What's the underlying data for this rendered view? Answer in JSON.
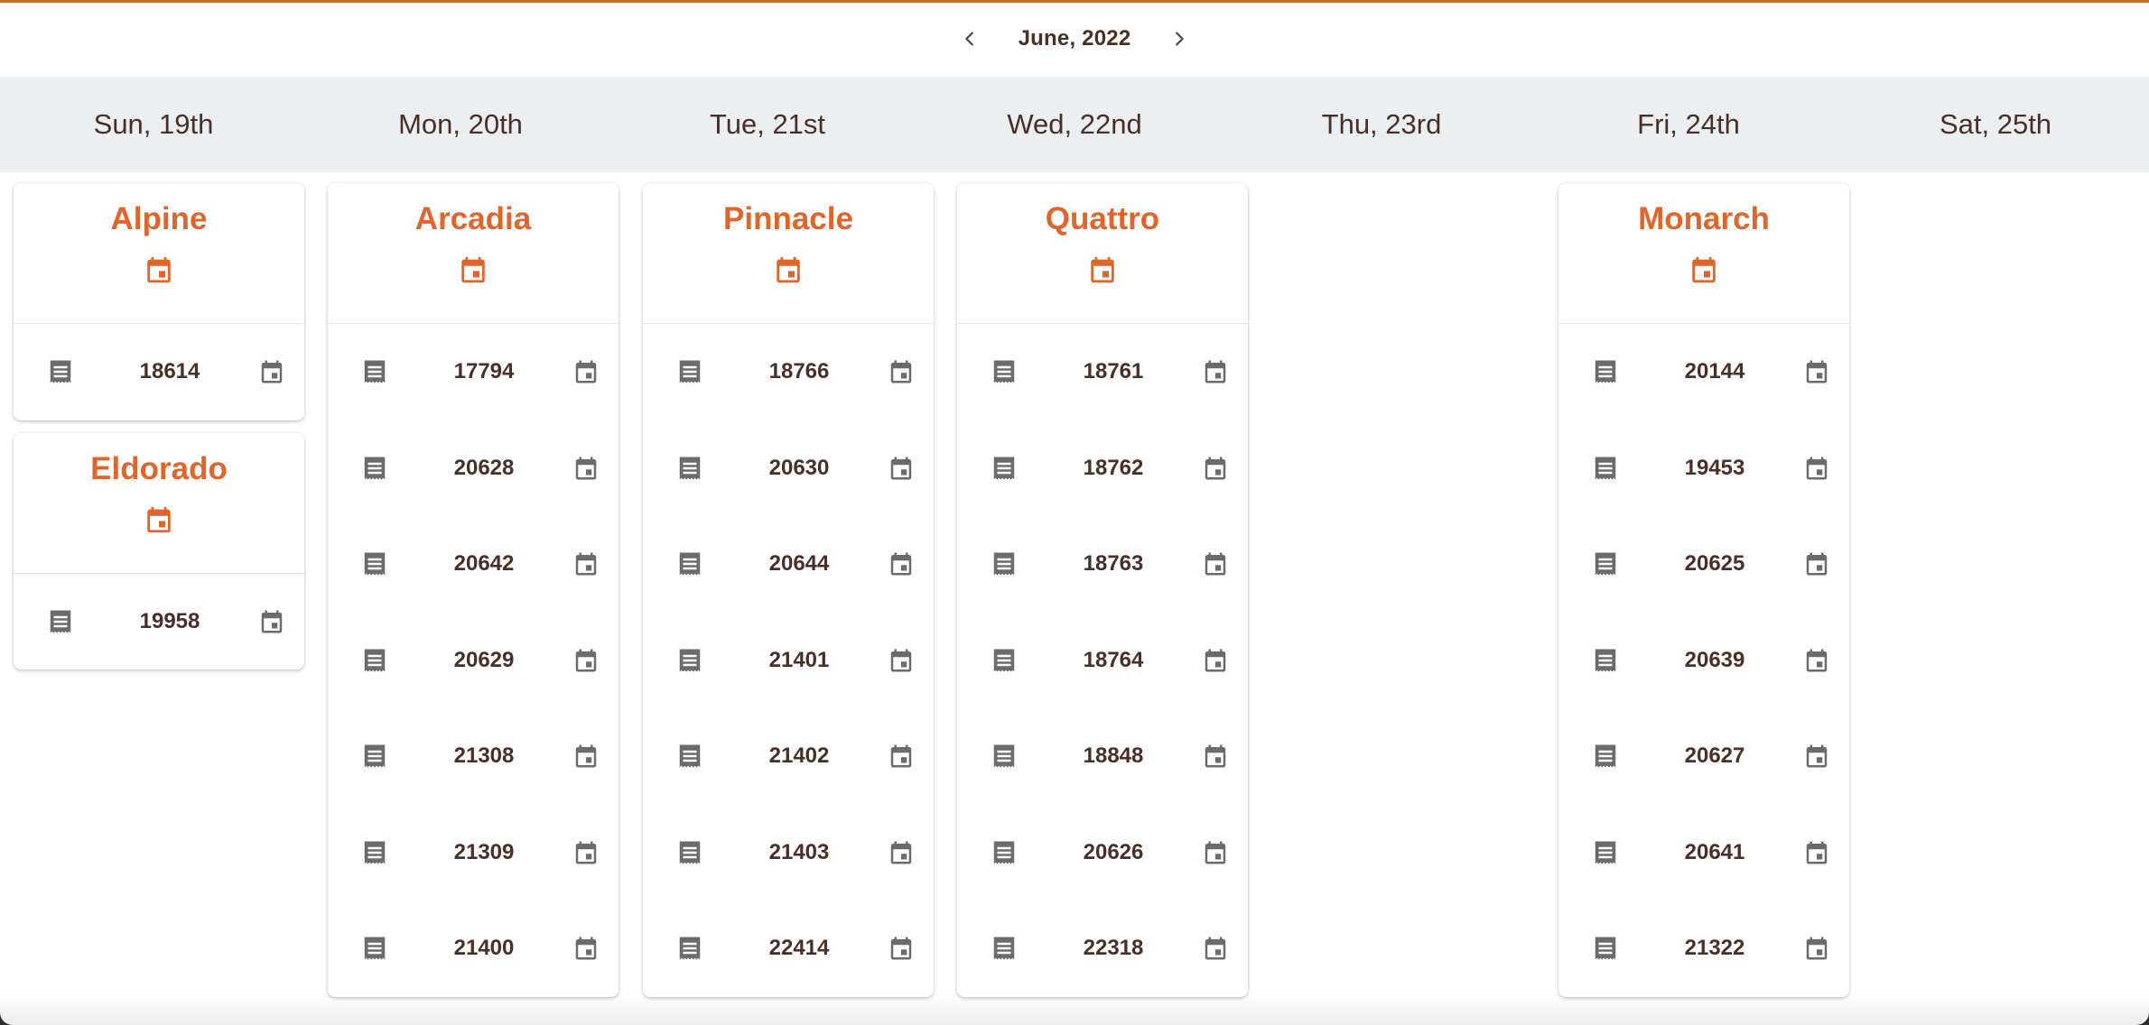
{
  "header": {
    "month": "June, 2022",
    "prev_icon": "chevron-left-icon",
    "next_icon": "chevron-right-icon"
  },
  "days": [
    "Sun, 19th",
    "Mon, 20th",
    "Tue, 21st",
    "Wed, 22nd",
    "Thu, 23rd",
    "Fri, 24th",
    "Sat, 25th"
  ],
  "colors": {
    "accent": "#e0652d",
    "text": "#4a2f26",
    "icon_gray": "#6b6b6b",
    "header_bg": "#eceff1"
  },
  "icons": {
    "row_left": "receipt-icon",
    "row_right": "event-icon",
    "card_head": "event-icon"
  },
  "cards": [
    {
      "day": "Sun, 19th",
      "title": "Alpine",
      "items": [
        "18614"
      ]
    },
    {
      "day": "Sun, 19th",
      "title": "Eldorado",
      "items": [
        "19958"
      ]
    },
    {
      "day": "Mon, 20th",
      "title": "Arcadia",
      "items": [
        "17794",
        "20628",
        "20642",
        "20629",
        "21308",
        "21309",
        "21400"
      ]
    },
    {
      "day": "Tue, 21st",
      "title": "Pinnacle",
      "items": [
        "18766",
        "20630",
        "20644",
        "21401",
        "21402",
        "21403",
        "22414"
      ]
    },
    {
      "day": "Wed, 22nd",
      "title": "Quattro",
      "items": [
        "18761",
        "18762",
        "18763",
        "18764",
        "18848",
        "20626",
        "22318"
      ]
    },
    {
      "day": "Fri, 24th",
      "title": "Monarch",
      "items": [
        "20144",
        "19453",
        "20625",
        "20639",
        "20627",
        "20641",
        "21322"
      ]
    }
  ]
}
